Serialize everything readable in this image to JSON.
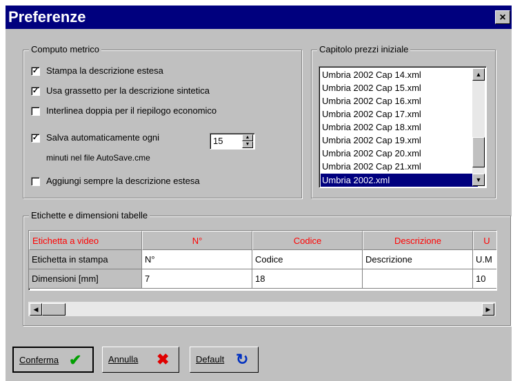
{
  "window": {
    "title": "Preferenze",
    "close_label": "×"
  },
  "computo": {
    "label": "Computo metrico",
    "options": [
      {
        "label": "Stampa la descrizione estesa",
        "checked": true
      },
      {
        "label": "Usa grassetto per la descrizione sintetica",
        "checked": true
      },
      {
        "label": "Interlinea doppia per il riepilogo economico",
        "checked": false
      },
      {
        "label": "Salva automaticamente ogni",
        "checked": true
      },
      {
        "label": "Aggiungi sempre la descrizione estesa",
        "checked": false
      }
    ],
    "autosave_note": "minuti nel file AutoSave.cme",
    "autosave_minutes": "15"
  },
  "capitolo": {
    "label": "Capitolo prezzi iniziale",
    "items": [
      "Umbria 2002 Cap 14.xml",
      "Umbria 2002 Cap 15.xml",
      "Umbria 2002 Cap 16.xml",
      "Umbria 2002 Cap 17.xml",
      "Umbria 2002 Cap 18.xml",
      "Umbria 2002 Cap 19.xml",
      "Umbria 2002 Cap 20.xml",
      "Umbria 2002 Cap 21.xml",
      "Umbria 2002.xml"
    ],
    "selected": "Umbria 2002.xml"
  },
  "etichette": {
    "label": "Etichette e dimensioni tabelle",
    "header": [
      "Etichetta a video",
      "N°",
      "Codice",
      "Descrizione",
      "U"
    ],
    "rows": [
      [
        "Etichetta in stampa",
        "N°",
        "Codice",
        "Descrizione",
        "U.M"
      ],
      [
        "Dimensioni [mm]",
        "7",
        "18",
        "",
        "10"
      ]
    ]
  },
  "buttons": {
    "confirm": "Conferma",
    "cancel": "Annulla",
    "default": "Default"
  },
  "colors": {
    "title_bar": "#00007e",
    "header_text": "#ff0000",
    "confirm_icon": "#00a000",
    "cancel_icon": "#e00000",
    "default_icon": "#0030c0"
  }
}
